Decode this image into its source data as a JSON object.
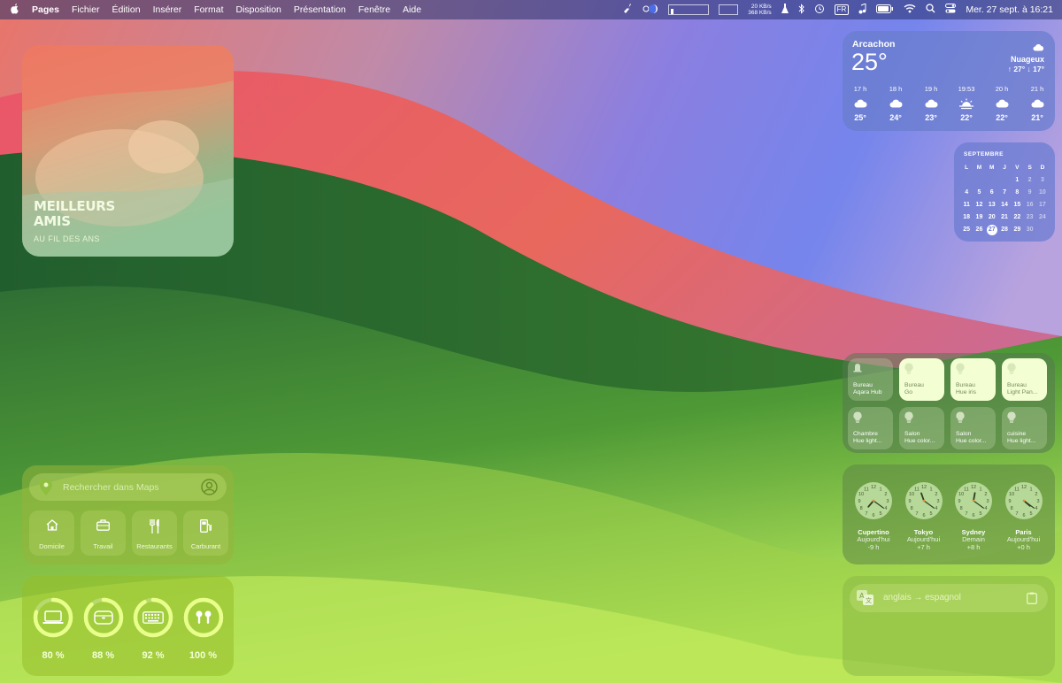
{
  "menubar": {
    "app": "Pages",
    "menus": [
      "Fichier",
      "Édition",
      "Insérer",
      "Format",
      "Disposition",
      "Présentation",
      "Fenêtre",
      "Aide"
    ],
    "net_up": "20 KB/s",
    "net_down": "368 KB/s",
    "input_source": "FR",
    "datetime": "Mer. 27 sept. à 16:21"
  },
  "photo": {
    "title_line1": "MEILLEURS",
    "title_line2": "AMIS",
    "subtitle": "AU FIL DES ANS"
  },
  "weather": {
    "city": "Arcachon",
    "temp": "25°",
    "condition": "Nuageux",
    "range": "↑ 27° ↓ 17°",
    "hours": [
      {
        "time": "17 h",
        "icon": "cloud-icon",
        "temp": "25°"
      },
      {
        "time": "18 h",
        "icon": "cloud-icon",
        "temp": "24°"
      },
      {
        "time": "19 h",
        "icon": "cloud-icon",
        "temp": "23°"
      },
      {
        "time": "19:53",
        "icon": "sunset-icon",
        "temp": "22°"
      },
      {
        "time": "20 h",
        "icon": "cloud-icon",
        "temp": "22°"
      },
      {
        "time": "21 h",
        "icon": "cloud-icon",
        "temp": "21°"
      }
    ]
  },
  "calendar": {
    "month": "SEPTEMBRE",
    "dow": [
      "L",
      "M",
      "M",
      "J",
      "V",
      "S",
      "D"
    ],
    "today": "27",
    "weeks": [
      [
        "",
        "",
        "",
        "",
        "1",
        "2",
        "3"
      ],
      [
        "4",
        "5",
        "6",
        "7",
        "8",
        "9",
        "10"
      ],
      [
        "11",
        "12",
        "13",
        "14",
        "15",
        "16",
        "17"
      ],
      [
        "18",
        "19",
        "20",
        "21",
        "22",
        "23",
        "24"
      ],
      [
        "25",
        "26",
        "27",
        "28",
        "29",
        "30",
        ""
      ]
    ]
  },
  "home": {
    "tiles": [
      {
        "room": "Bureau",
        "device": "Aqara Hub",
        "icon": "hub-icon",
        "on": false
      },
      {
        "room": "Bureau",
        "device": "Go",
        "icon": "bulb-icon",
        "on": true
      },
      {
        "room": "Bureau",
        "device": "Hue iris",
        "icon": "bulb-icon",
        "on": true
      },
      {
        "room": "Bureau",
        "device": "Light Pan...",
        "icon": "bulb-icon",
        "on": true
      },
      {
        "room": "Chambre",
        "device": "Hue light...",
        "icon": "bulb-icon",
        "on": false
      },
      {
        "room": "Salon",
        "device": "Hue color...",
        "icon": "bulb-icon",
        "on": false
      },
      {
        "room": "Salon",
        "device": "Hue color...",
        "icon": "bulb-icon",
        "on": false
      },
      {
        "room": "cuisine",
        "device": "Hue light...",
        "icon": "bulb-icon",
        "on": false
      }
    ]
  },
  "clocks": [
    {
      "city": "Cupertino",
      "day": "Aujourd'hui",
      "offset": "-9 h",
      "hour": 7,
      "minute": 21
    },
    {
      "city": "Tokyo",
      "day": "Aujourd'hui",
      "offset": "+7 h",
      "hour": 23,
      "minute": 21
    },
    {
      "city": "Sydney",
      "day": "Demain",
      "offset": "+8 h",
      "hour": 0,
      "minute": 21
    },
    {
      "city": "Paris",
      "day": "Aujourd'hui",
      "offset": "+0 h",
      "hour": 16,
      "minute": 21
    }
  ],
  "translate": {
    "label": "anglais → espagnol"
  },
  "maps": {
    "placeholder": "Rechercher dans Maps",
    "shortcuts": [
      {
        "label": "Domicile",
        "icon": "house-icon"
      },
      {
        "label": "Travail",
        "icon": "briefcase-icon"
      },
      {
        "label": "Restaurants",
        "icon": "fork-knife-icon"
      },
      {
        "label": "Carburant",
        "icon": "fuel-pump-icon"
      }
    ]
  },
  "batteries": [
    {
      "device": "laptop-icon",
      "percent": "80 %",
      "level": 0.8
    },
    {
      "device": "case-icon",
      "percent": "88 %",
      "level": 0.88
    },
    {
      "device": "keyboard-icon",
      "percent": "92 %",
      "level": 0.92
    },
    {
      "device": "airpods-icon",
      "percent": "100 %",
      "level": 1.0
    }
  ]
}
